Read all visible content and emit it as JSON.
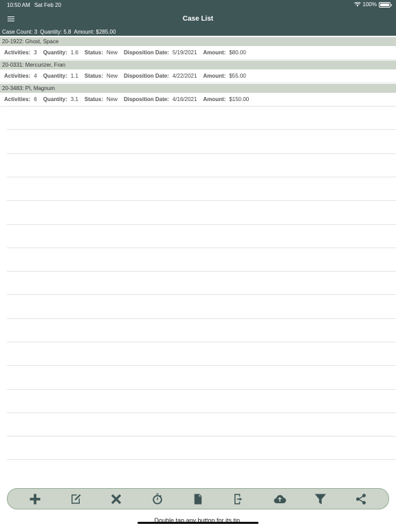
{
  "status_bar": {
    "time": "10:50 AM",
    "date": "Sat Feb 20",
    "battery": "100%"
  },
  "nav": {
    "title": "Case List",
    "menu_icon": "hamburger-icon"
  },
  "summary": {
    "count": "Case Count: 3",
    "quantity": "Quantity: 5.8",
    "amount": "Amount: $285.00"
  },
  "labels": {
    "activities": "Activities:",
    "quantity": "Quantity:",
    "status": "Status:",
    "disposition": "Disposition Date:",
    "amount": "Amount:"
  },
  "cases": [
    {
      "header": "20-1922: Ghost, Space",
      "activities": "3",
      "quantity": "1.6",
      "status": "New",
      "disposition": "5/19/2021",
      "amount": "$80.00"
    },
    {
      "header": "20-0331: Mercurizer, Fran",
      "activities": "4",
      "quantity": "1.1",
      "status": "New",
      "disposition": "4/22/2021",
      "amount": "$55.00"
    },
    {
      "header": "20-3483: PI, Magnum",
      "activities": "6",
      "quantity": "3.1",
      "status": "New",
      "disposition": "4/16/2021",
      "amount": "$150.00"
    }
  ],
  "toolbar": {
    "buttons": [
      "add-icon",
      "edit-icon",
      "delete-icon",
      "timer-icon",
      "document-icon",
      "export-icon",
      "cloud-upload-icon",
      "filter-icon",
      "share-icon"
    ]
  },
  "tip": "Double tap any button for its tip.",
  "colors": {
    "header_bg": "#3f5656",
    "case_header_bg": "#cdd5cb",
    "toolbar_border": "#96ad98"
  }
}
